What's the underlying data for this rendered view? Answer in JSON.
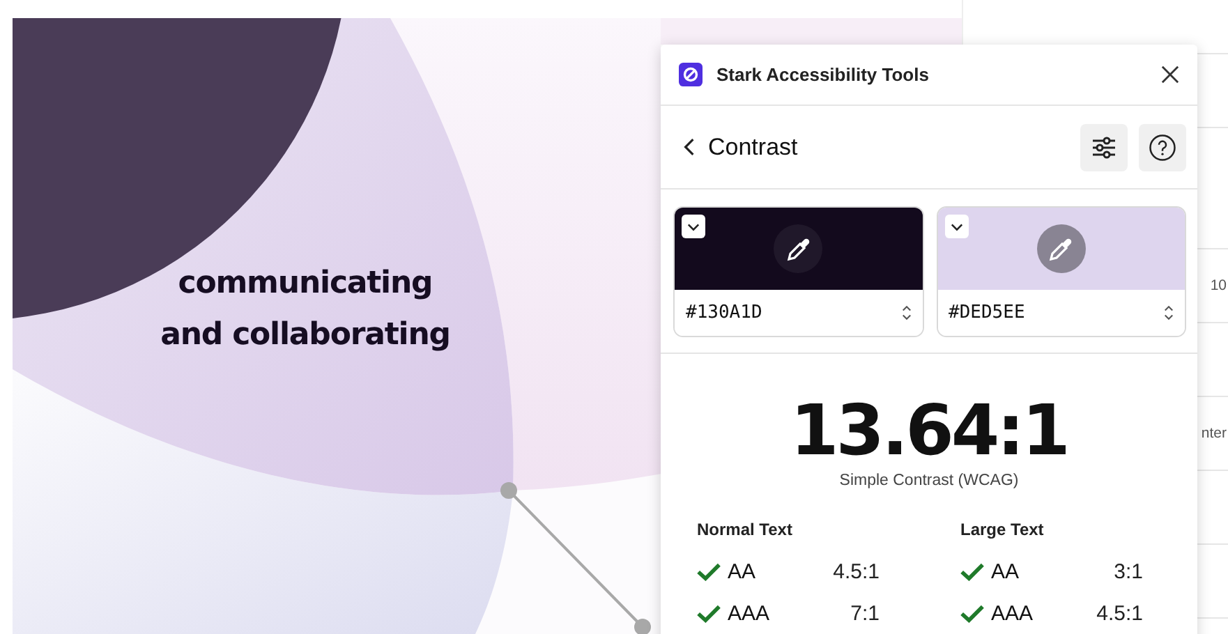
{
  "canvas": {
    "heading_lines": [
      "communicating",
      "and collaborating"
    ]
  },
  "properties_panel": {
    "texts": [
      "10",
      "nter"
    ]
  },
  "plugin": {
    "title": "Stark Accessibility Tools",
    "page": "Contrast",
    "colors": [
      {
        "hex": "#130A1D",
        "color": "#130a1d"
      },
      {
        "hex": "#DED5EE",
        "color": "#ded5ee"
      }
    ],
    "ratio": "13.64:1",
    "method": "Simple Contrast (WCAG)",
    "groups": [
      {
        "title": "Normal Text",
        "checks": [
          {
            "grade": "AA",
            "target": "4.5:1",
            "passed": true
          },
          {
            "grade": "AAA",
            "target": "7:1",
            "passed": true
          }
        ]
      },
      {
        "title": "Large Text",
        "checks": [
          {
            "grade": "AA",
            "target": "3:1",
            "passed": true
          },
          {
            "grade": "AAA",
            "target": "4.5:1",
            "passed": true
          }
        ]
      }
    ]
  }
}
